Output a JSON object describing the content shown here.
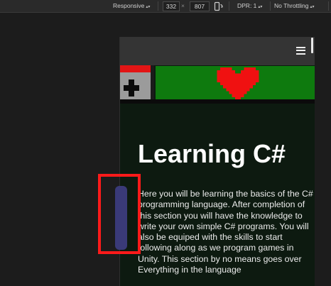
{
  "devtools": {
    "device_mode": "Responsive",
    "width_value": "332",
    "times_symbol": "×",
    "height_value": "807",
    "dpr_label": "DPR: 1",
    "throttle_label": "No Throttling",
    "rotate_icon": "rotate-device-icon"
  },
  "page": {
    "menu_icon": "hamburger-menu-icon",
    "title": "Learning C#",
    "intro": "Here you will be learning the basics of the C# programming language. After completion of this section you will have the knowledge to write your own simple C# programs. You will also be equiped with the skills to start following along as we program games in Unity. This section by no means goes over Everything in the language",
    "logo_icon": "csharp-pixel-logo-icon",
    "heart_icon": "pixel-heart-icon"
  },
  "colors": {
    "banner_green": "#0e7a0e",
    "heart_red": "#f01111",
    "page_background": "#0d1a10",
    "annotation_red": "#ff1a1a",
    "side_tab": "#3a3a78"
  }
}
